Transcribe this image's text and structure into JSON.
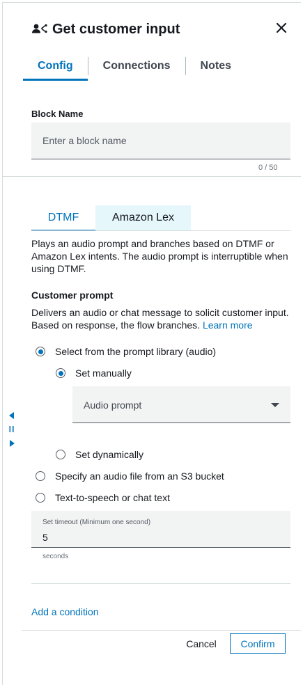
{
  "header": {
    "title": "Get customer input",
    "icon": "customer-input-icon"
  },
  "tabs": [
    {
      "label": "Config"
    },
    {
      "label": "Connections"
    },
    {
      "label": "Notes"
    }
  ],
  "block_name": {
    "label": "Block Name",
    "placeholder": "Enter a block name",
    "counter": "0 / 50"
  },
  "subtabs": [
    {
      "label": "DTMF"
    },
    {
      "label": "Amazon Lex"
    }
  ],
  "description": "Plays an audio prompt and branches based on DTMF or Amazon Lex intents. The audio prompt is interruptible when using DTMF.",
  "customer_prompt": {
    "heading": "Customer prompt",
    "description": "Delivers an audio or chat message to solicit customer input. Based on response, the flow branches.",
    "learn_more": "Learn more"
  },
  "options": {
    "library": "Select from the prompt library (audio)",
    "set_manually": "Set manually",
    "audio_prompt": "Audio prompt",
    "set_dynamically": "Set dynamically",
    "s3": "Specify an audio file from an S3 bucket",
    "tts": "Text-to-speech or chat text"
  },
  "timeout": {
    "label": "Set timeout (Minimum one second)",
    "value": "5",
    "unit": "seconds"
  },
  "add_condition": "Add a condition",
  "footer": {
    "cancel": "Cancel",
    "confirm": "Confirm"
  },
  "colors": {
    "accent": "#0073bb",
    "field_bg": "#f2f3f3",
    "lex_tab_bg": "#e6f7fb"
  }
}
